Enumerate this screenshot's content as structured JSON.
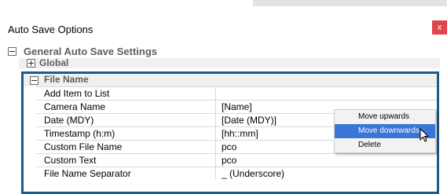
{
  "window": {
    "title": "Auto Save Options",
    "close_label": "x"
  },
  "tree": {
    "general": {
      "label": "General Auto Save Settings"
    },
    "global": {
      "label": "Global"
    },
    "file_name": {
      "label": "File Name"
    },
    "rows": [
      {
        "name": "Add Item to List",
        "value": ""
      },
      {
        "name": "Camera Name",
        "value": "[Name]"
      },
      {
        "name": "Date (MDY)",
        "value": "[Date (MDY)]"
      },
      {
        "name": "Timestamp (h:m)",
        "value": "[hh::mm]"
      },
      {
        "name": "Custom File Name",
        "value": "pco"
      },
      {
        "name": "Custom Text",
        "value": "pco"
      },
      {
        "name": "File Name Separator",
        "value": "_ (Underscore)"
      }
    ]
  },
  "context_menu": {
    "items": [
      {
        "label": "Move upwards"
      },
      {
        "label": "Move downwards"
      },
      {
        "label": "Delete"
      }
    ],
    "selected_index": 1
  },
  "colors": {
    "accent_border": "#1a5c8a",
    "close_bg": "#e1464c",
    "menu_highlight": "#3a75d8"
  }
}
